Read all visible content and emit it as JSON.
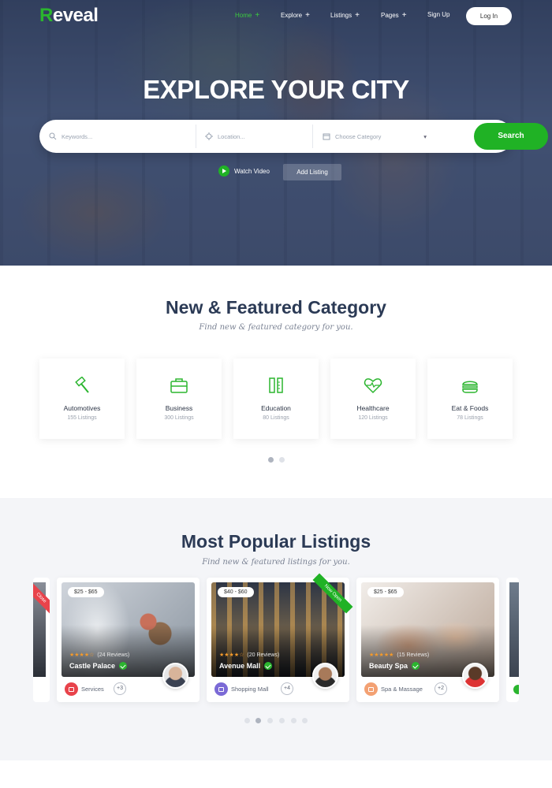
{
  "brand": {
    "first_letter": "R",
    "rest": "eveal",
    "accent": "#2bb52f"
  },
  "nav": {
    "items": [
      {
        "label": "Home",
        "plus": "+",
        "active": true
      },
      {
        "label": "Explore",
        "plus": "+"
      },
      {
        "label": "Listings",
        "plus": "+"
      },
      {
        "label": "Pages",
        "plus": "+"
      },
      {
        "label": "Sign Up",
        "plus": ""
      }
    ],
    "login": "Log In"
  },
  "hero": {
    "title": "EXPLORE YOUR CITY",
    "keywords_placeholder": "Keywords...",
    "location_placeholder": "Location...",
    "category_placeholder": "Choose Category",
    "search": "Search",
    "watch_video": "Watch Video",
    "add_listing": "Add Listing"
  },
  "categories": {
    "title": "New & Featured Category",
    "subtitle": "Find new & featured category for you.",
    "items": [
      {
        "name": "Automotives",
        "count": "155 Listings",
        "icon": "hammer-icon"
      },
      {
        "name": "Business",
        "count": "300 Listings",
        "icon": "briefcase-icon"
      },
      {
        "name": "Education",
        "count": "80 Listings",
        "icon": "pencil-ruler-icon"
      },
      {
        "name": "Healthcare",
        "count": "120 Listings",
        "icon": "heart-pulse-icon"
      },
      {
        "name": "Eat & Foods",
        "count": "78 Listings",
        "icon": "burger-icon"
      }
    ]
  },
  "listings": {
    "title": "Most Popular Listings",
    "subtitle": "Find new & featured listings for you.",
    "left_ribbon": "Close",
    "items": [
      {
        "price": "$25 - $65",
        "stars": "★★★★☆",
        "reviews": "(24 Reviews)",
        "name": "Castle Palace",
        "category": "Services",
        "more": "+3",
        "cat_color": "#e8434b"
      },
      {
        "price": "$40 - $60",
        "stars": "★★★★☆",
        "reviews": "(20 Reviews)",
        "name": "Avenue Mall",
        "category": "Shopping Mall",
        "more": "+4",
        "cat_color": "#7b6ad6",
        "ribbon": "Now Open"
      },
      {
        "price": "$25 - $65",
        "stars": "★★★★★",
        "reviews": "(15 Reviews)",
        "name": "Beauty Spa",
        "category": "Spa & Massage",
        "more": "+2",
        "cat_color": "#f3a173"
      }
    ]
  }
}
